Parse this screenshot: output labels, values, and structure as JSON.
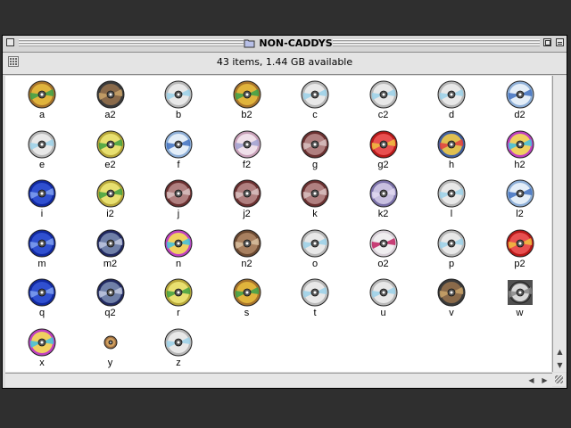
{
  "window": {
    "title": "NON-CADDYS",
    "status": "43 items, 1.44 GB available"
  },
  "icons": [
    {
      "label": "a",
      "style": "gold"
    },
    {
      "label": "a2",
      "style": "dark"
    },
    {
      "label": "b",
      "style": "silver"
    },
    {
      "label": "b2",
      "style": "gold"
    },
    {
      "label": "c",
      "style": "silver"
    },
    {
      "label": "c2",
      "style": "silver"
    },
    {
      "label": "d",
      "style": "silver"
    },
    {
      "label": "d2",
      "style": "bluesilver"
    },
    {
      "label": "e",
      "style": "silver"
    },
    {
      "label": "e2",
      "style": "goldgreen"
    },
    {
      "label": "f",
      "style": "bluesilver"
    },
    {
      "label": "f2",
      "style": "pink"
    },
    {
      "label": "g",
      "style": "darkred"
    },
    {
      "label": "g2",
      "style": "red"
    },
    {
      "label": "h",
      "style": "colorful"
    },
    {
      "label": "h2",
      "style": "rainbow"
    },
    {
      "label": "i",
      "style": "blue"
    },
    {
      "label": "i2",
      "style": "goldgreen"
    },
    {
      "label": "j",
      "style": "darkred"
    },
    {
      "label": "j2",
      "style": "darkred"
    },
    {
      "label": "k",
      "style": "darkred"
    },
    {
      "label": "k2",
      "style": "purple"
    },
    {
      "label": "l",
      "style": "silver"
    },
    {
      "label": "l2",
      "style": "bluesilver"
    },
    {
      "label": "m",
      "style": "blue"
    },
    {
      "label": "m2",
      "style": "darkblue"
    },
    {
      "label": "n",
      "style": "rainbow"
    },
    {
      "label": "n2",
      "style": "brown"
    },
    {
      "label": "o",
      "style": "silver"
    },
    {
      "label": "o2",
      "style": "magenta"
    },
    {
      "label": "p",
      "style": "silver"
    },
    {
      "label": "p2",
      "style": "red"
    },
    {
      "label": "q",
      "style": "blue"
    },
    {
      "label": "q2",
      "style": "darkblue"
    },
    {
      "label": "r",
      "style": "goldgreen"
    },
    {
      "label": "s",
      "style": "gold"
    },
    {
      "label": "t",
      "style": "silver"
    },
    {
      "label": "u",
      "style": "silver"
    },
    {
      "label": "v",
      "style": "dark"
    },
    {
      "label": "w",
      "style": "square"
    },
    {
      "label": "x",
      "style": "rainbow"
    },
    {
      "label": "y",
      "style": "small"
    },
    {
      "label": "z",
      "style": "silver"
    }
  ],
  "disc_styles": {
    "gold": {
      "outer": "#a8742a",
      "mid": "#e0b43c",
      "stripe": "#3aa04a"
    },
    "dark": {
      "outer": "#3a3a3a",
      "mid": "#8a6a4a",
      "stripe": "#c9a36a"
    },
    "silver": {
      "outer": "#b8b8b8",
      "mid": "#e8e8e8",
      "stripe": "#9ad0e8"
    },
    "bluesilver": {
      "outer": "#8fb0d8",
      "mid": "#e4eef8",
      "stripe": "#4070c0"
    },
    "goldgreen": {
      "outer": "#b8a83a",
      "mid": "#e8e070",
      "stripe": "#40a040"
    },
    "pink": {
      "outer": "#c8a0b8",
      "mid": "#f0e0ea",
      "stripe": "#a0a0d0"
    },
    "darkred": {
      "outer": "#6a3030",
      "mid": "#b08080",
      "stripe": "#d8c0c0"
    },
    "red": {
      "outer": "#b81818",
      "mid": "#e85050",
      "stripe": "#f0c040"
    },
    "colorful": {
      "outer": "#4060a0",
      "mid": "#e0c050",
      "stripe": "#e04040"
    },
    "rainbow": {
      "outer": "#c040c0",
      "mid": "#f0d060",
      "stripe": "#40c0e0"
    },
    "blue": {
      "outer": "#1028a0",
      "mid": "#3050d0",
      "stripe": "#80a0f0"
    },
    "darkblue": {
      "outer": "#202860",
      "mid": "#7080a8",
      "stripe": "#c0c8e0"
    },
    "brown": {
      "outer": "#6a4830",
      "mid": "#a88060",
      "stripe": "#d8c0a0"
    },
    "magenta": {
      "outer": "#d8d0d8",
      "mid": "#f0eef0",
      "stripe": "#c02060"
    },
    "purple": {
      "outer": "#7a70a8",
      "mid": "#c8c0e0",
      "stripe": "#e0d8f0"
    },
    "small": {
      "outer": "#a07040",
      "mid": "#d0a060",
      "stripe": "#705030"
    },
    "square": {
      "outer": "#505050",
      "mid": "#d8d8d8",
      "stripe": "#888888"
    }
  }
}
